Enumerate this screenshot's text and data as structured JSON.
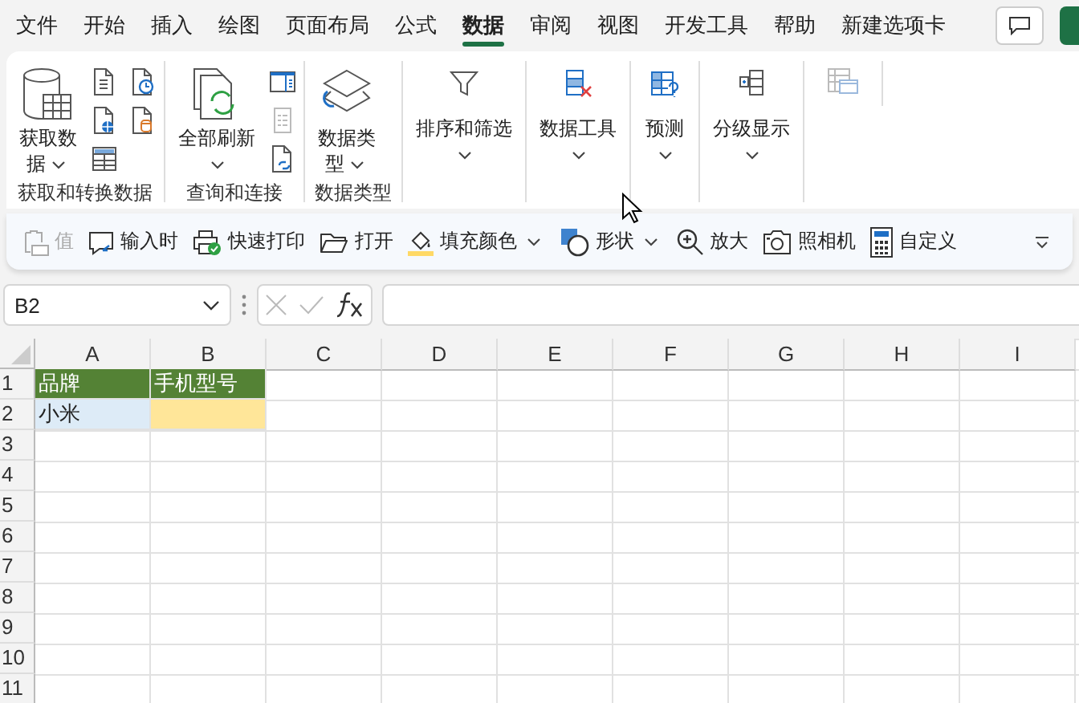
{
  "menu_tabs": [
    {
      "label": "文件",
      "selected": false
    },
    {
      "label": "开始",
      "selected": false
    },
    {
      "label": "插入",
      "selected": false
    },
    {
      "label": "绘图",
      "selected": false
    },
    {
      "label": "页面布局",
      "selected": false
    },
    {
      "label": "公式",
      "selected": false
    },
    {
      "label": "数据",
      "selected": true
    },
    {
      "label": "审阅",
      "selected": false
    },
    {
      "label": "视图",
      "selected": false
    },
    {
      "label": "开发工具",
      "selected": false
    },
    {
      "label": "帮助",
      "selected": false
    },
    {
      "label": "新建选项卡",
      "selected": false
    }
  ],
  "ribbon_groups": [
    {
      "label": "获取和转换数据",
      "button": {
        "label": "获取数据",
        "dropdown": true
      }
    },
    {
      "label": "查询和连接",
      "button": {
        "label": "全部刷新",
        "dropdown": true
      }
    },
    {
      "label": "数据类型",
      "button": {
        "label": "数据类型",
        "dropdown": true
      }
    },
    {
      "button": {
        "label": "排序和筛选",
        "dropdown": true
      }
    },
    {
      "button": {
        "label": "数据工具",
        "dropdown": true
      }
    },
    {
      "button": {
        "label": "预测",
        "dropdown": true
      }
    },
    {
      "button": {
        "label": "分级显示",
        "dropdown": true
      }
    }
  ],
  "quick_toolbar": [
    {
      "label": "值",
      "disabled": true,
      "dropdown": false
    },
    {
      "label": "输入时",
      "disabled": false,
      "dropdown": false
    },
    {
      "label": "快速打印",
      "disabled": false,
      "dropdown": false
    },
    {
      "label": "打开",
      "disabled": false,
      "dropdown": false
    },
    {
      "label": "填充颜色",
      "disabled": false,
      "dropdown": true
    },
    {
      "label": "形状",
      "disabled": false,
      "dropdown": true
    },
    {
      "label": "放大",
      "disabled": false,
      "dropdown": false
    },
    {
      "label": "照相机",
      "disabled": false,
      "dropdown": false
    },
    {
      "label": "自定义",
      "disabled": false,
      "dropdown": false
    }
  ],
  "name_box": "B2",
  "grid": {
    "columns": [
      "A",
      "B",
      "C",
      "D",
      "E",
      "F",
      "G",
      "H",
      "I"
    ],
    "rows": [
      {
        "header": "1",
        "cells": [
          {
            "text": "品牌",
            "color": "#548235"
          },
          {
            "text": "手机型号",
            "color": "#548235"
          }
        ]
      },
      {
        "header": "2",
        "cells": [
          {
            "text": "小米",
            "color": "#ddebf7"
          },
          {
            "text": "",
            "color": "#ffe699"
          }
        ]
      },
      {
        "header": "3",
        "cells": []
      },
      {
        "header": "4",
        "cells": []
      },
      {
        "header": "5",
        "cells": []
      },
      {
        "header": "6",
        "cells": []
      },
      {
        "header": "7",
        "cells": []
      },
      {
        "header": "8",
        "cells": []
      },
      {
        "header": "9",
        "cells": []
      },
      {
        "header": "10",
        "cells": []
      },
      {
        "header": "11",
        "cells": []
      }
    ]
  }
}
